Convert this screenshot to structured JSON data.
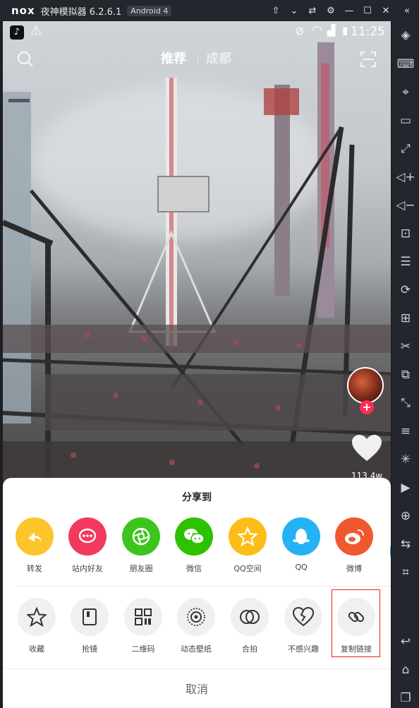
{
  "emulator": {
    "logo": "nox",
    "app_name": "夜神模拟器 6.2.6.1",
    "android_badge": "Android 4",
    "title_controls": [
      "pin-icon",
      "chevron-down-icon",
      "transfer-icon",
      "gear-icon",
      "minimize-icon",
      "maximize-icon",
      "close-icon",
      "collapse-icon"
    ],
    "toolbar": [
      "rotate-icon",
      "keyboard-icon",
      "location-icon",
      "screen-icon",
      "fullscreen-icon",
      "volume-up-icon",
      "volume-down-icon",
      "screenshot-icon",
      "multi-instance-icon",
      "shake-icon",
      "apk-install-icon",
      "scissors-icon",
      "resize-icon",
      "expand-icon",
      "menu-icon",
      "loading-icon",
      "video-record-icon",
      "macro-icon",
      "sync-icon",
      "target-icon",
      "back-icon",
      "home-icon",
      "recent-apps-icon"
    ]
  },
  "status_bar": {
    "time": "11:25"
  },
  "top_nav": {
    "tabs": [
      {
        "label": "推荐",
        "active": true
      },
      {
        "label": "成都",
        "active": false
      }
    ]
  },
  "video": {
    "like_count": "113.4w"
  },
  "share_sheet": {
    "title": "分享到",
    "share_targets": [
      {
        "label": "转发",
        "color": "#fdc52c",
        "icon": "forward-icon"
      },
      {
        "label": "站内好友",
        "color": "#f23a5f",
        "icon": "chat-bubble-icon"
      },
      {
        "label": "朋友圈",
        "color": "#3ec41f",
        "icon": "moments-aperture-icon"
      },
      {
        "label": "微信",
        "color": "#2dc100",
        "icon": "wechat-icon"
      },
      {
        "label": "QQ空间",
        "color": "#fdbd18",
        "icon": "qzone-star-icon"
      },
      {
        "label": "QQ",
        "color": "#25b2f4",
        "icon": "qq-penguin-icon"
      },
      {
        "label": "微博",
        "color": "#f0582f",
        "icon": "weibo-icon"
      }
    ],
    "actions": [
      {
        "label": "收藏",
        "icon": "star-icon"
      },
      {
        "label": "抢镜",
        "icon": "frame-icon"
      },
      {
        "label": "二维码",
        "icon": "qr-code-icon"
      },
      {
        "label": "动态壁纸",
        "icon": "wallpaper-icon"
      },
      {
        "label": "合拍",
        "icon": "duet-icon"
      },
      {
        "label": "不感兴趣",
        "icon": "broken-heart-icon"
      },
      {
        "label": "复制链接",
        "icon": "link-icon"
      }
    ],
    "cancel_label": "取消"
  }
}
